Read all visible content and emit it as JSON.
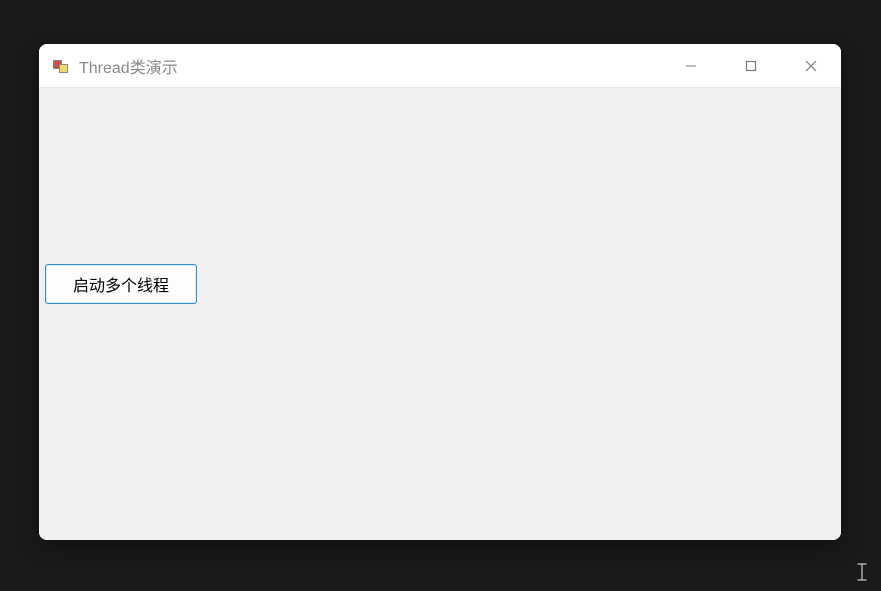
{
  "window": {
    "title": "Thread类演示"
  },
  "button": {
    "start_label": "启动多个线程"
  }
}
